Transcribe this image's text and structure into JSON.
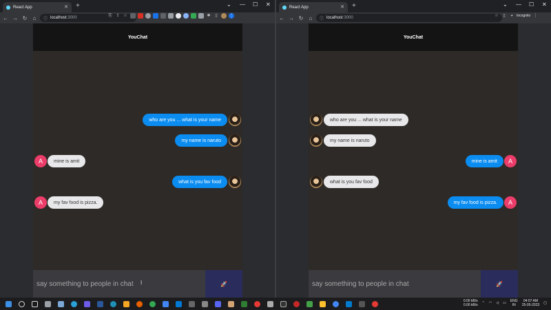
{
  "left_window": {
    "tab_title": "React App",
    "url_host": "localhost",
    "url_port": ":3000",
    "app_title": "YouChat",
    "messages": [
      {
        "text": "who are you ... what is your name",
        "side": "right",
        "avatar": "naruto"
      },
      {
        "text": "my name is naruto",
        "side": "right",
        "avatar": "naruto"
      },
      {
        "text": "mine is amit",
        "side": "left",
        "avatar": "A"
      },
      {
        "text": "what is you fav food",
        "side": "right",
        "avatar": "naruto"
      },
      {
        "text": "my fav food is pizza.",
        "side": "left",
        "avatar": "A"
      }
    ],
    "input_placeholder": "say something to people in chat"
  },
  "right_window": {
    "tab_title": "React App",
    "url_host": "localhost",
    "url_port": ":3000",
    "profile_label": "Incognito",
    "app_title": "YouChat",
    "messages": [
      {
        "text": "who are you ... what is your name",
        "side": "left",
        "avatar": "naruto"
      },
      {
        "text": "my name is naruto",
        "side": "left",
        "avatar": "naruto"
      },
      {
        "text": "mine is amit",
        "side": "right",
        "avatar": "A"
      },
      {
        "text": "what is you fav food",
        "side": "left",
        "avatar": "naruto"
      },
      {
        "text": "my fav food is pizza.",
        "side": "right",
        "avatar": "A"
      }
    ],
    "input_placeholder": "say something to people in chat"
  },
  "taskbar": {
    "net_up": "0.00 kB/s",
    "net_down": "0.00 kB/s",
    "lang_1": "ENG",
    "lang_2": "IN",
    "time": "04:07 AM",
    "date": "25-05-2023"
  },
  "colors": {
    "outgoing_bubble": "#0b8cf0",
    "incoming_bubble": "#e8e8ea",
    "letter_avatar": "#ec3d6a",
    "send_button": "#2a2d5c"
  }
}
